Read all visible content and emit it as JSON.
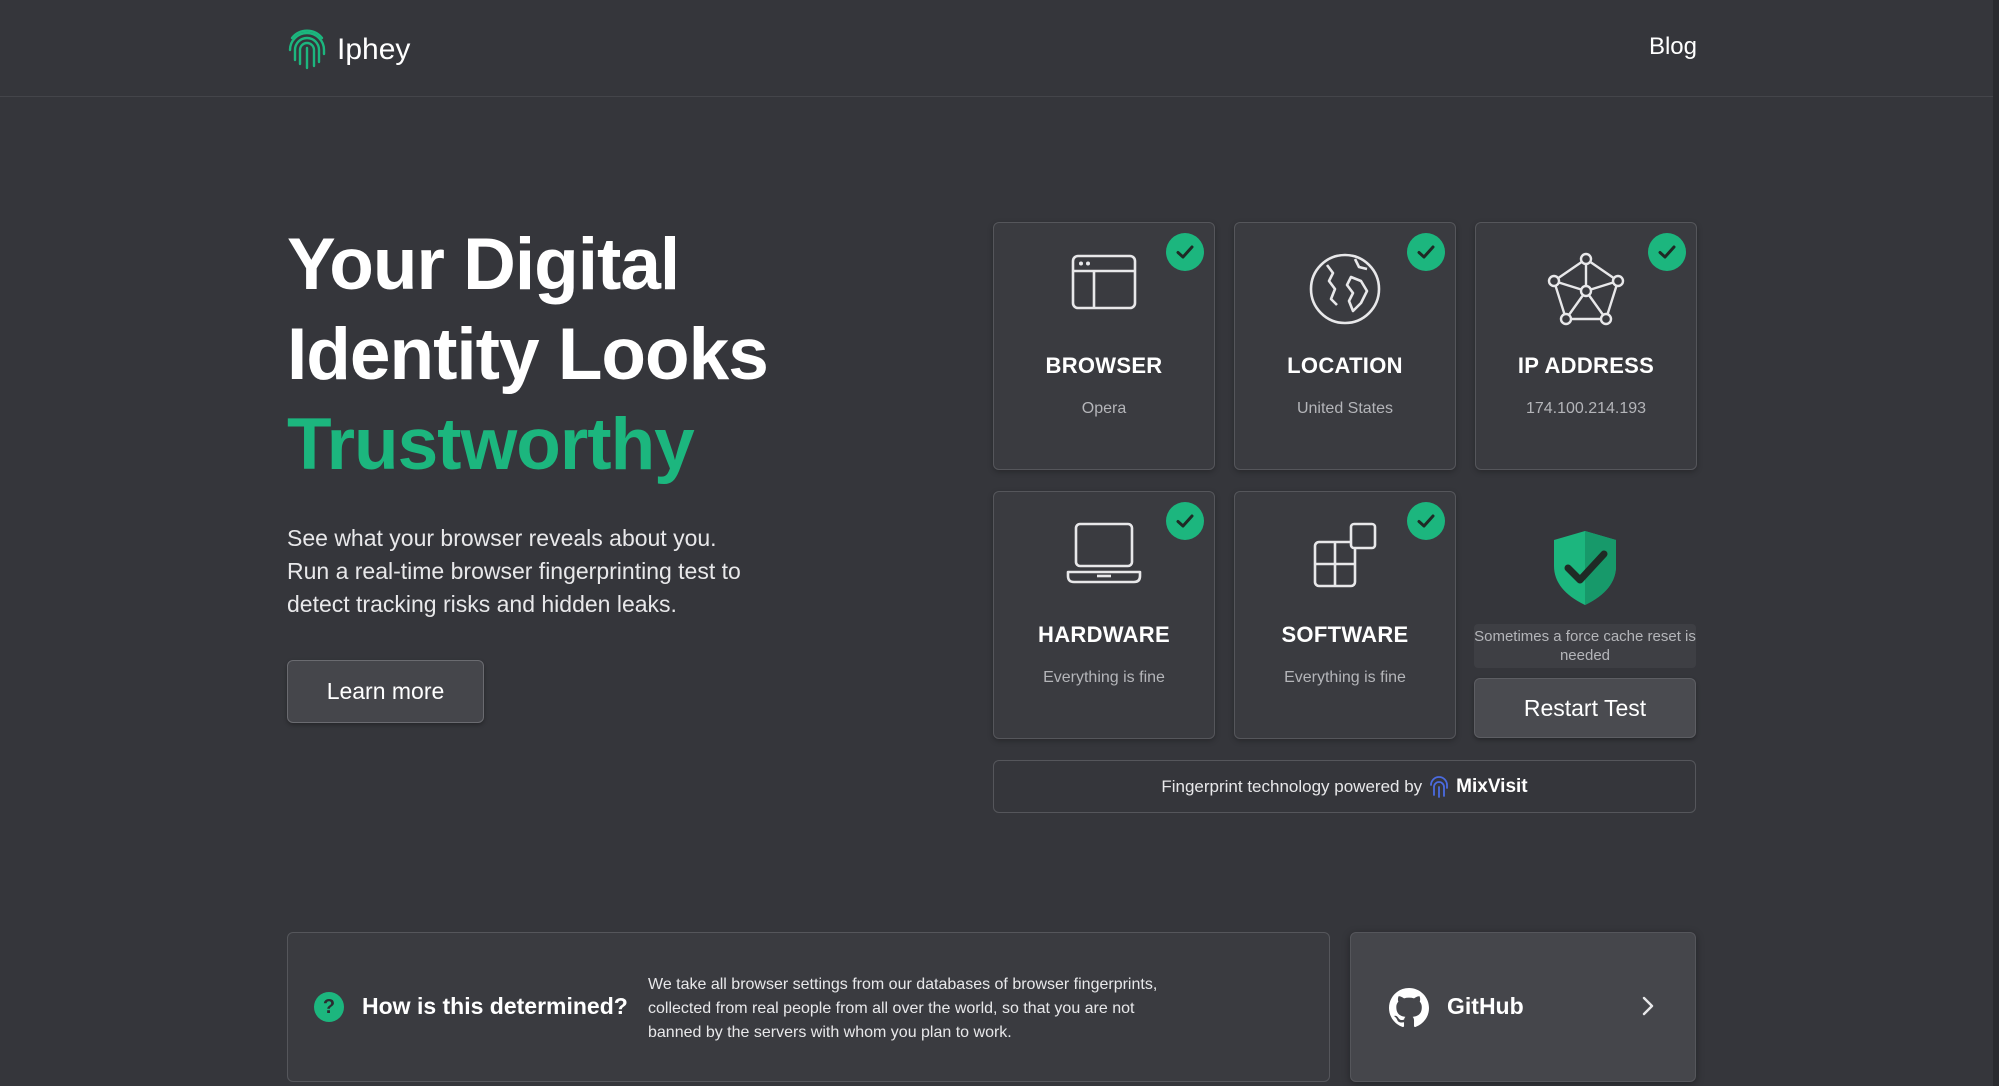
{
  "header": {
    "logo_text": "Iphey",
    "nav_blog": "Blog"
  },
  "hero": {
    "title_line1": "Your Digital",
    "title_line2": "Identity Looks",
    "title_accent": "Trustworthy",
    "description": "See what your browser reveals about you. Run a real-time browser fingerprinting test to detect tracking risks and hidden leaks.",
    "learn_more": "Learn more"
  },
  "cards": [
    {
      "title": "BROWSER",
      "value": "Opera",
      "icon": "browser-window-icon",
      "status": "ok"
    },
    {
      "title": "LOCATION",
      "value": "United States",
      "icon": "globe-icon",
      "status": "ok"
    },
    {
      "title": "IP ADDRESS",
      "value": "174.100.214.193",
      "icon": "network-icon",
      "status": "ok"
    },
    {
      "title": "HARDWARE",
      "value": "Everything is fine",
      "icon": "laptop-icon",
      "status": "ok"
    },
    {
      "title": "SOFTWARE",
      "value": "Everything is fine",
      "icon": "apps-icon",
      "status": "ok"
    }
  ],
  "result": {
    "cache_note": "Sometimes a force cache reset is needed",
    "restart_label": "Restart Test"
  },
  "powered": {
    "text": "Fingerprint technology powered by",
    "brand": "MixVisit"
  },
  "info": {
    "title": "How is this determined?",
    "text": "We take all browser settings from our databases of browser fingerprints, collected from real people from all over the world, so that you are not banned by the servers with whom you plan to work."
  },
  "github": {
    "label": "GitHub"
  },
  "colors": {
    "background": "#35363b",
    "accent": "#1cb67e",
    "card": "#3a3b40"
  }
}
